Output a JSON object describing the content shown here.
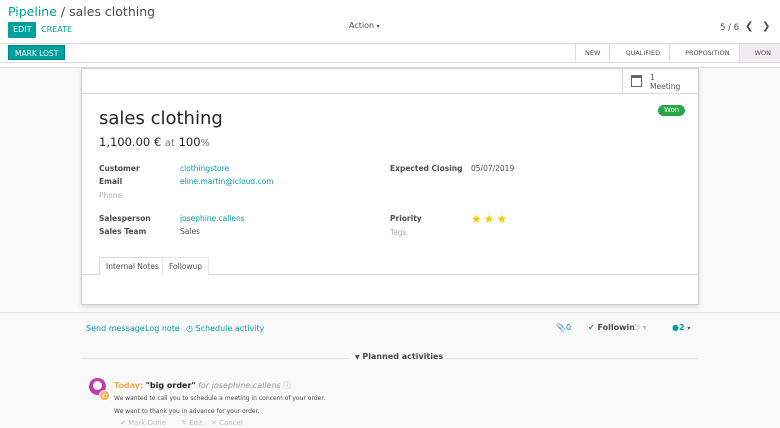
{
  "breadcrumb": {
    "parent": "Pipeline",
    "separator": "/",
    "current": "sales clothing"
  },
  "toolbar": {
    "edit_label": "EDIT",
    "create_label": "CREATE",
    "action_label": "Action",
    "pager": "5 / 6"
  },
  "statusbar": {
    "mark_lost_label": "MARK LOST",
    "stages": [
      "NEW",
      "QUALIFIED",
      "PROPOSITION",
      "WON"
    ],
    "active_stage": "WON"
  },
  "button_box": {
    "meeting_count": "1",
    "meeting_label": "Meeting"
  },
  "ribbon": "Won",
  "record": {
    "title": "sales clothing",
    "revenue": "1,100.00 €",
    "at": "at",
    "probability": "100",
    "percent_sign": "%"
  },
  "fields": {
    "customer_label": "Customer",
    "customer": "clothingstore",
    "email_label": "Email",
    "email": "eline.martin@icloud.com",
    "phone_label": "Phone",
    "salesperson_label": "Salesperson",
    "salesperson": "josephine.callens",
    "team_label": "Sales Team",
    "team": "Sales",
    "closing_label": "Expected Closing",
    "closing": "05/07/2019",
    "priority_label": "Priority",
    "priority_stars": 3,
    "tags_label": "Tags"
  },
  "tabs": [
    "Internal Notes",
    "Followup"
  ],
  "chatter": {
    "send_message": "Send message",
    "log_note": "Log note",
    "schedule_activity": "Schedule activity",
    "attachments": "0",
    "following": "Followin",
    "followers": "2",
    "planned_label": "Planned activities"
  },
  "activity": {
    "when": "Today:",
    "summary": "\"big order\"",
    "for": "for josephine.callens",
    "line1": "We wanted to call you to schedule a meeting in concern of your order.",
    "line2": "We want to thank you in advance for your order.",
    "mark_done": "Mark Done",
    "edit": "Edit",
    "cancel": "Cancel"
  },
  "colors": {
    "accent": "#00A09D",
    "won": "#28a745",
    "star": "#f3cc00",
    "today": "#f0ad4e",
    "avatar": "#c239b3"
  }
}
